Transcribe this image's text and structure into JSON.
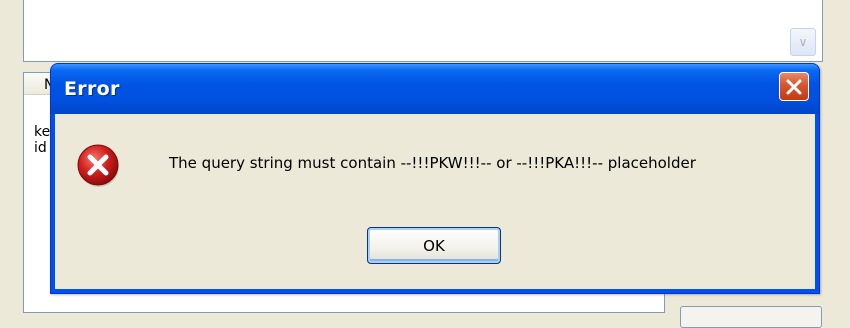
{
  "background": {
    "column_header_fragment": "N",
    "rows": [
      "ke",
      "id"
    ],
    "scroll_icon": "chevron-down-icon"
  },
  "dialog": {
    "title": "Error",
    "close_icon": "close-icon",
    "icon": "error-icon",
    "message": "The query string must contain --!!!PKW!!!-- or --!!!PKA!!!-- placeholder",
    "ok_label": "OK"
  },
  "colors": {
    "titlebar": "#0054e3",
    "close_button": "#d8542f",
    "dialog_body": "#ece9d8",
    "error_icon": "#d11f1f"
  }
}
